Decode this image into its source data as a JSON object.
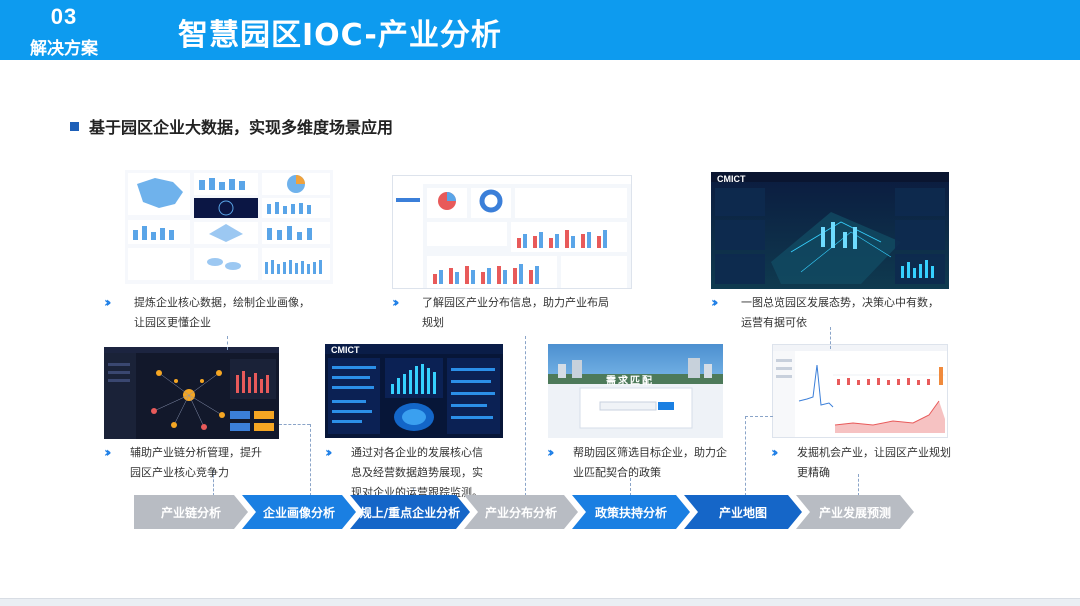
{
  "header": {
    "section_number": "03",
    "section_name": "解决方案",
    "title": "智慧园区IOC-产业分析",
    "bg_color": "#0d9bef"
  },
  "subtitle": "基于园区企业大数据，实现多维度场景应用",
  "thumbs": {
    "d3_brand": "CMICT",
    "e2_brand": "CMICT",
    "f3_banner": "需求匹配"
  },
  "captions": {
    "c1": [
      "提炼企业核心数据，绘制企业画像，",
      "让园区更懂企业"
    ],
    "c2": [
      "了解园区产业分布信息，助力产业布局",
      "规划"
    ],
    "c3": [
      "一图总览园区发展态势，决策心中有数，",
      "运营有据可依"
    ],
    "c4": [
      "辅助产业链分析管理，提升",
      "园区产业核心竞争力"
    ],
    "c5": [
      "通过对各企业的发展核心信",
      "息及经营数据趋势展现，实",
      "现对企业的运营跟踪监测。"
    ],
    "c6": [
      "帮助园区筛选目标企业，助力企",
      "业匹配契合的政策"
    ],
    "c7": [
      "发掘机会产业，让园区产业规划",
      "更精确"
    ]
  },
  "steps": [
    {
      "label": "产业链分析",
      "color": "gray"
    },
    {
      "label": "企业画像分析",
      "color": "blue"
    },
    {
      "label": "规上/重点企业分析",
      "color": "dblue"
    },
    {
      "label": "产业分布分析",
      "color": "gray"
    },
    {
      "label": "政策扶持分析",
      "color": "blue"
    },
    {
      "label": "产业地图",
      "color": "dblue"
    },
    {
      "label": "产业发展预测",
      "color": "gray"
    }
  ]
}
